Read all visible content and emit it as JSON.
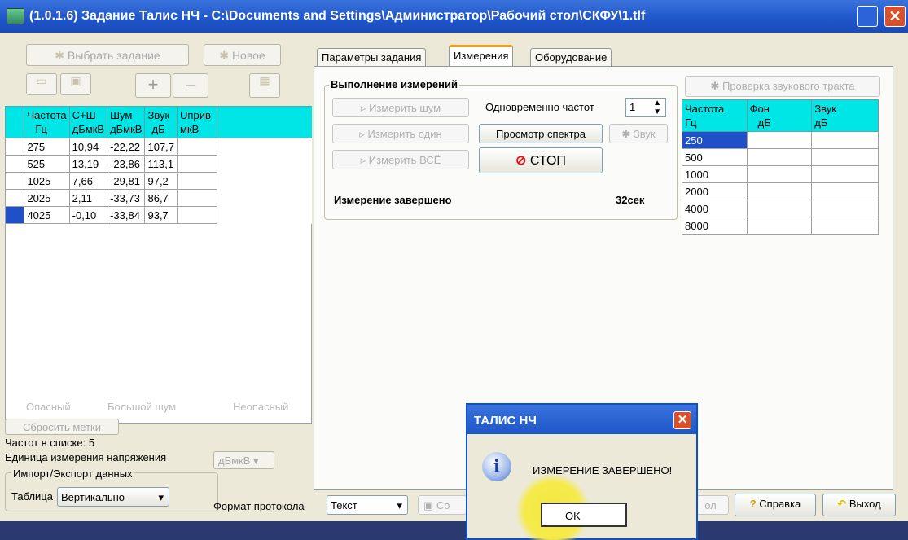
{
  "window": {
    "title": "(1.0.1.6) Задание Талис НЧ - C:\\Documents and Settings\\Администратор\\Рабочий стол\\СКФУ\\1.tlf"
  },
  "left": {
    "select_task": "Выбрать задание",
    "new": "Новое",
    "columns": [
      [
        "Частота",
        "Гц"
      ],
      [
        "С+Ш",
        "дБмкВ"
      ],
      [
        "Шум",
        "дБмкВ"
      ],
      [
        "Звук",
        "дБ"
      ],
      [
        "Uприв",
        "мкВ"
      ]
    ],
    "rows": [
      [
        "275",
        "10,94",
        "-22,22",
        "107,7",
        ""
      ],
      [
        "525",
        "13,19",
        "-23,86",
        "113,1",
        ""
      ],
      [
        "1025",
        "7,66",
        "-29,81",
        "97,2",
        ""
      ],
      [
        "2025",
        "2,11",
        "-33,73",
        "86,7",
        ""
      ],
      [
        "4025",
        "-0,10",
        "-33,84",
        "93,7",
        ""
      ]
    ],
    "marks": [
      "Опасный",
      "Большой шум",
      "Неопасный"
    ],
    "reset_marks": "Сбросить метки",
    "freq_count": "Частот в списке: 5",
    "units_label": "Единица измерения напряжения",
    "units_value": "дБмкВ",
    "import_export": "Импорт/Экспорт данных",
    "table_label": "Таблица",
    "table_value": "Вертикально"
  },
  "tabs": [
    "Параметры задания",
    "Измерения",
    "Оборудование"
  ],
  "measure": {
    "group": "Выполнение измерений",
    "measure_noise": "Измерить шум",
    "measure_one": "Измерить один",
    "measure_all": "Измерить ВСЁ",
    "simultaneous": "Одновременно частот",
    "simultaneous_value": "1",
    "spectrum": "Просмотр спектра",
    "sound": "Звук",
    "stop": "СТОП",
    "status": "Измерение завершено",
    "time": "32сек"
  },
  "check": {
    "button": "Проверка звукового тракта",
    "columns": [
      [
        "Частота",
        "Гц"
      ],
      [
        "Фон",
        "дБ"
      ],
      [
        "Звук",
        "дБ"
      ]
    ],
    "freqs": [
      "250",
      "500",
      "1000",
      "2000",
      "4000",
      "8000"
    ]
  },
  "bottom": {
    "protocol_label": "Формат протокола",
    "protocol_value": "Текст",
    "save_partial": "Со",
    "log_partial": "ол",
    "help": "Справка",
    "exit": "Выход"
  },
  "dialog": {
    "title": "ТАЛИС НЧ",
    "message": "ИЗМЕРЕНИЕ ЗАВЕРШЕНО!",
    "ok": "OK"
  }
}
